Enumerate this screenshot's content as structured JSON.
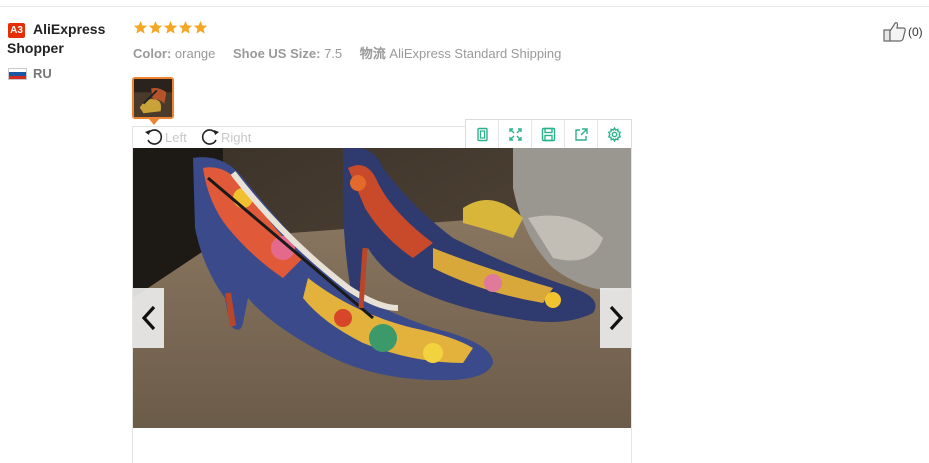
{
  "reviewer": {
    "badge": "A3",
    "name": "AliExpress Shopper",
    "country": "RU",
    "flag_colors": [
      "#ffffff",
      "#1c57a6",
      "#d52b1e"
    ]
  },
  "review": {
    "rating": 5,
    "star_color": "#f5a623",
    "attributes": [
      {
        "key": "Color:",
        "value": "orange"
      },
      {
        "key": "Shoe US Size:",
        "value": "7.5"
      },
      {
        "key": "物流",
        "value": "AliExpress Standard Shipping"
      }
    ],
    "helpful_count": "(0)"
  },
  "viewer": {
    "rotate_left_label": "Left",
    "rotate_right_label": "Right",
    "toolbar_icons": [
      "fit-screen-icon",
      "fullscreen-icon",
      "save-icon",
      "open-new-window-icon",
      "settings-icon"
    ],
    "accent_color": "#2bb28d",
    "thumbnail_border_color": "#f08332"
  }
}
